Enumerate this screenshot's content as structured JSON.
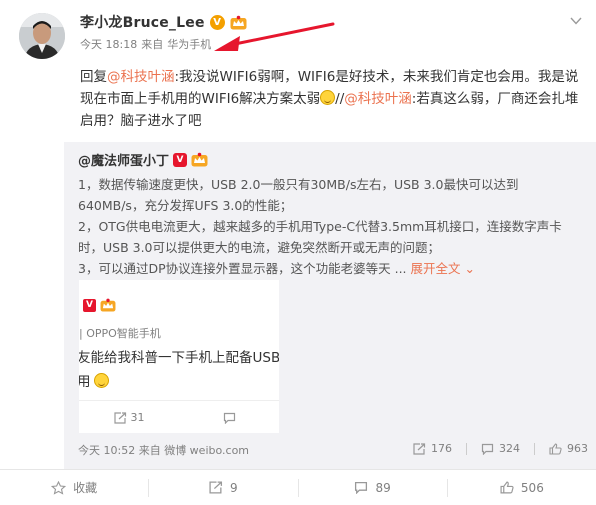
{
  "post": {
    "author_name": "李小龙Bruce_Lee",
    "time": "今天 18:18",
    "from_label": "来自",
    "source": "华为手机",
    "reply_text": {
      "prefix": "回复",
      "mention1": "@科技叶涵",
      "body1": ":我没说WIFI6弱啊，WIFI6是好技术，未来我们肯定也会用。我是说现在市面上手机用的WIFI6解决方案太弱",
      "sep": "//",
      "mention2": "@科技叶涵",
      "body2": ":若真这么弱，厂商还会扎堆启用？脑子进水了吧"
    }
  },
  "original": {
    "author": "@魔法师蛋小丁",
    "lines": [
      "1，数据传输速度更快，USB 2.0一般只有30MB/s左右，USB 3.0最快可以达到640MB/s，充分发挥UFS 3.0的性能；",
      "2，OTG供电电流更大，越来越多的手机用Type-C代替3.5mm耳机接口，连接数字声卡时，USB 3.0可以提供更大的电流，避免突然断开或无声的问题；",
      "3，可以通过DP协议连接外置显示器，这个功能老婆等天 ... "
    ],
    "expand_label": "展开全文",
    "expand_arrow": "⌄",
    "embed": {
      "line2": "| OPPO智能手机",
      "line3": "友能给我科普一下手机上配备USB",
      "line4": "用",
      "repost_count": "31"
    },
    "footer": {
      "time": "今天 10:52 来自 微博 weibo.com",
      "reposts": "176",
      "comments": "324",
      "likes": "963"
    }
  },
  "actions": {
    "favorite": "收藏",
    "repost": "9",
    "comment": "89",
    "like": "506"
  },
  "colors": {
    "accent": "#eb7350",
    "muted": "#808080",
    "repost_bg": "#f2f2f5",
    "arrow": "#e6162d"
  }
}
